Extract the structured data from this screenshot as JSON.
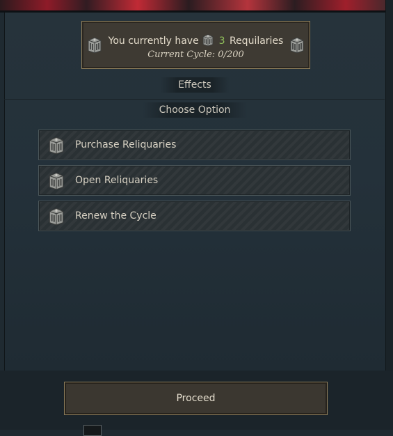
{
  "status": {
    "prefix": "You currently have",
    "count": "3",
    "unit": "Requilaries",
    "cycle": "Current Cycle: 0/200",
    "icon": "reliquary-icon"
  },
  "tabs": {
    "effects": "Effects",
    "choose_option": "Choose Option"
  },
  "options": [
    {
      "label": "Purchase Reliquaries",
      "icon": "reliquary-icon"
    },
    {
      "label": "Open Reliquaries",
      "icon": "reliquary-icon"
    },
    {
      "label": "Renew the Cycle",
      "icon": "reliquary-icon"
    }
  ],
  "proceed": {
    "label": "Proceed"
  },
  "colors": {
    "accent_gold": "#8e7e5b",
    "count_green": "#8fbf5a",
    "banner_red": "#c12a35"
  }
}
